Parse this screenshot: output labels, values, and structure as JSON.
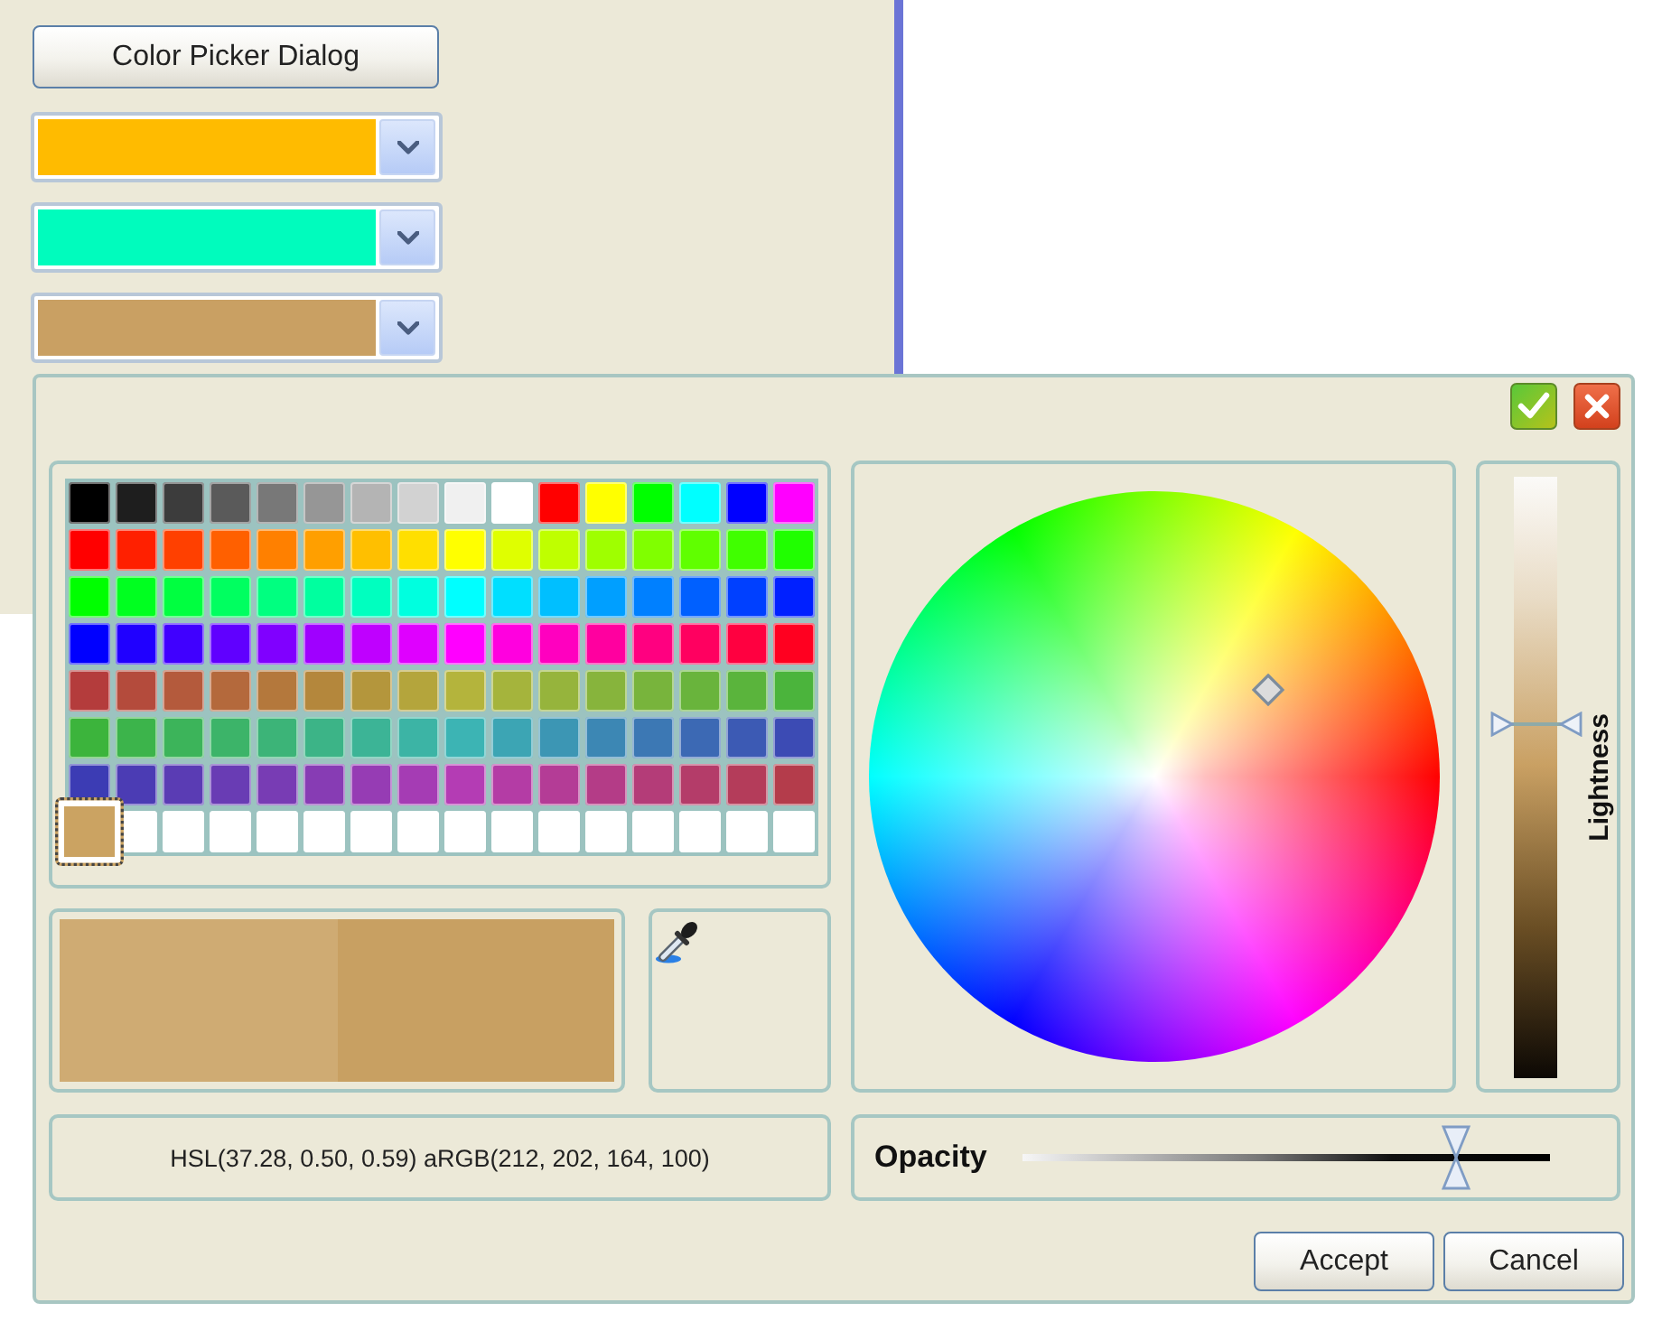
{
  "main_window": {
    "button": "Color Picker Dialog",
    "color_dropdowns": [
      {
        "color": "#ffbb00"
      },
      {
        "color": "#00fcbd"
      },
      {
        "color": "#c9a063"
      }
    ]
  },
  "dialog": {
    "palette": [
      [
        {
          "color": "#000000",
          "selected": false
        },
        {
          "color": "#1e1e1e",
          "selected": false
        },
        {
          "color": "#3c3c3c",
          "selected": false
        },
        {
          "color": "#5a5a5a",
          "selected": false
        },
        {
          "color": "#787878",
          "selected": false
        },
        {
          "color": "#969696",
          "selected": false
        },
        {
          "color": "#b4b4b4",
          "selected": false
        },
        {
          "color": "#d2d2d2",
          "selected": false
        },
        {
          "color": "#f0f0f0",
          "selected": false
        },
        {
          "color": "#ffffff",
          "selected": false
        },
        {
          "color": "#ff0000",
          "selected": false
        },
        {
          "color": "#ffff00",
          "selected": false
        },
        {
          "color": "#00ff00",
          "selected": false
        },
        {
          "color": "#00ffff",
          "selected": false
        },
        {
          "color": "#0000ff",
          "selected": false
        },
        {
          "color": "#ff00ff",
          "selected": false
        }
      ],
      [
        {
          "color": "#ff0000",
          "selected": false
        },
        {
          "color": "#ff2000",
          "selected": false
        },
        {
          "color": "#ff4000",
          "selected": false
        },
        {
          "color": "#ff6000",
          "selected": false
        },
        {
          "color": "#ff8000",
          "selected": false
        },
        {
          "color": "#ff9f00",
          "selected": false
        },
        {
          "color": "#ffbf00",
          "selected": false
        },
        {
          "color": "#ffdf00",
          "selected": false
        },
        {
          "color": "#ffff00",
          "selected": false
        },
        {
          "color": "#dfff00",
          "selected": false
        },
        {
          "color": "#bfff00",
          "selected": false
        },
        {
          "color": "#9fff00",
          "selected": false
        },
        {
          "color": "#80ff00",
          "selected": false
        },
        {
          "color": "#60ff00",
          "selected": false
        },
        {
          "color": "#40ff00",
          "selected": false
        },
        {
          "color": "#20ff00",
          "selected": false
        }
      ],
      [
        {
          "color": "#00ff00",
          "selected": false
        },
        {
          "color": "#00ff20",
          "selected": false
        },
        {
          "color": "#00ff40",
          "selected": false
        },
        {
          "color": "#00ff60",
          "selected": false
        },
        {
          "color": "#00ff80",
          "selected": false
        },
        {
          "color": "#00ff9f",
          "selected": false
        },
        {
          "color": "#00ffbf",
          "selected": false
        },
        {
          "color": "#00ffdf",
          "selected": false
        },
        {
          "color": "#00ffff",
          "selected": false
        },
        {
          "color": "#00dfff",
          "selected": false
        },
        {
          "color": "#00bfff",
          "selected": false
        },
        {
          "color": "#009fff",
          "selected": false
        },
        {
          "color": "#0080ff",
          "selected": false
        },
        {
          "color": "#0060ff",
          "selected": false
        },
        {
          "color": "#0040ff",
          "selected": false
        },
        {
          "color": "#0020ff",
          "selected": false
        }
      ],
      [
        {
          "color": "#0000ff",
          "selected": false
        },
        {
          "color": "#2000ff",
          "selected": false
        },
        {
          "color": "#4000ff",
          "selected": false
        },
        {
          "color": "#6000ff",
          "selected": false
        },
        {
          "color": "#8000ff",
          "selected": false
        },
        {
          "color": "#9f00ff",
          "selected": false
        },
        {
          "color": "#bf00ff",
          "selected": false
        },
        {
          "color": "#df00ff",
          "selected": false
        },
        {
          "color": "#ff00ff",
          "selected": false
        },
        {
          "color": "#ff00df",
          "selected": false
        },
        {
          "color": "#ff00bf",
          "selected": false
        },
        {
          "color": "#ff009f",
          "selected": false
        },
        {
          "color": "#ff0080",
          "selected": false
        },
        {
          "color": "#ff0060",
          "selected": false
        },
        {
          "color": "#ff0040",
          "selected": false
        },
        {
          "color": "#ff0020",
          "selected": false
        }
      ],
      [
        {
          "color": "#b43c3c",
          "selected": false
        },
        {
          "color": "#b44b3c",
          "selected": false
        },
        {
          "color": "#b45a3c",
          "selected": false
        },
        {
          "color": "#b4693c",
          "selected": false
        },
        {
          "color": "#b4783c",
          "selected": false
        },
        {
          "color": "#b4873c",
          "selected": false
        },
        {
          "color": "#b4963c",
          "selected": false
        },
        {
          "color": "#b4a53c",
          "selected": false
        },
        {
          "color": "#b4b43c",
          "selected": false
        },
        {
          "color": "#a5b43c",
          "selected": false
        },
        {
          "color": "#96b43c",
          "selected": false
        },
        {
          "color": "#87b43c",
          "selected": false
        },
        {
          "color": "#78b43c",
          "selected": false
        },
        {
          "color": "#69b43c",
          "selected": false
        },
        {
          "color": "#5ab43c",
          "selected": false
        },
        {
          "color": "#4bb43c",
          "selected": false
        }
      ],
      [
        {
          "color": "#3cb43c",
          "selected": false
        },
        {
          "color": "#3cb44b",
          "selected": false
        },
        {
          "color": "#3cb45a",
          "selected": false
        },
        {
          "color": "#3cb469",
          "selected": false
        },
        {
          "color": "#3cb478",
          "selected": false
        },
        {
          "color": "#3cb487",
          "selected": false
        },
        {
          "color": "#3cb496",
          "selected": false
        },
        {
          "color": "#3cb4a5",
          "selected": false
        },
        {
          "color": "#3cb4b4",
          "selected": false
        },
        {
          "color": "#3ca5b4",
          "selected": false
        },
        {
          "color": "#3c96b4",
          "selected": false
        },
        {
          "color": "#3c87b4",
          "selected": false
        },
        {
          "color": "#3c78b4",
          "selected": false
        },
        {
          "color": "#3c69b4",
          "selected": false
        },
        {
          "color": "#3c5ab4",
          "selected": false
        },
        {
          "color": "#3c4bb4",
          "selected": false
        }
      ],
      [
        {
          "color": "#3c3cb4",
          "selected": false
        },
        {
          "color": "#4b3cb4",
          "selected": false
        },
        {
          "color": "#5a3cb4",
          "selected": false
        },
        {
          "color": "#693cb4",
          "selected": false
        },
        {
          "color": "#783cb4",
          "selected": false
        },
        {
          "color": "#873cb4",
          "selected": false
        },
        {
          "color": "#963cb4",
          "selected": false
        },
        {
          "color": "#a53cb4",
          "selected": false
        },
        {
          "color": "#b43cb4",
          "selected": false
        },
        {
          "color": "#b43ca5",
          "selected": false
        },
        {
          "color": "#b43c96",
          "selected": false
        },
        {
          "color": "#b43c87",
          "selected": false
        },
        {
          "color": "#b43c78",
          "selected": false
        },
        {
          "color": "#b43c69",
          "selected": false
        },
        {
          "color": "#b43c5a",
          "selected": false
        },
        {
          "color": "#b43c4b",
          "selected": false
        }
      ],
      [
        {
          "color": "#cba362",
          "selected": true
        },
        {
          "color": "#ffffff",
          "selected": false
        },
        {
          "color": "#ffffff",
          "selected": false
        },
        {
          "color": "#ffffff",
          "selected": false
        },
        {
          "color": "#ffffff",
          "selected": false
        },
        {
          "color": "#ffffff",
          "selected": false
        },
        {
          "color": "#ffffff",
          "selected": false
        },
        {
          "color": "#ffffff",
          "selected": false
        },
        {
          "color": "#ffffff",
          "selected": false
        },
        {
          "color": "#ffffff",
          "selected": false
        },
        {
          "color": "#ffffff",
          "selected": false
        },
        {
          "color": "#ffffff",
          "selected": false
        },
        {
          "color": "#ffffff",
          "selected": false
        },
        {
          "color": "#ffffff",
          "selected": false
        },
        {
          "color": "#ffffff",
          "selected": false
        },
        {
          "color": "#ffffff",
          "selected": false
        }
      ]
    ],
    "preview": [
      {
        "color": "#cfab73"
      },
      {
        "color": "#c8a062"
      }
    ],
    "color_value": "HSL(37.28, 0.50, 0.59) aRGB(212, 202, 164, 100)",
    "lightness": {
      "label": "Lightness",
      "level": 0.59
    },
    "opacity": {
      "label": "Opacity",
      "level": 0.82
    },
    "buttons": [
      "Accept",
      "Cancel"
    ]
  }
}
